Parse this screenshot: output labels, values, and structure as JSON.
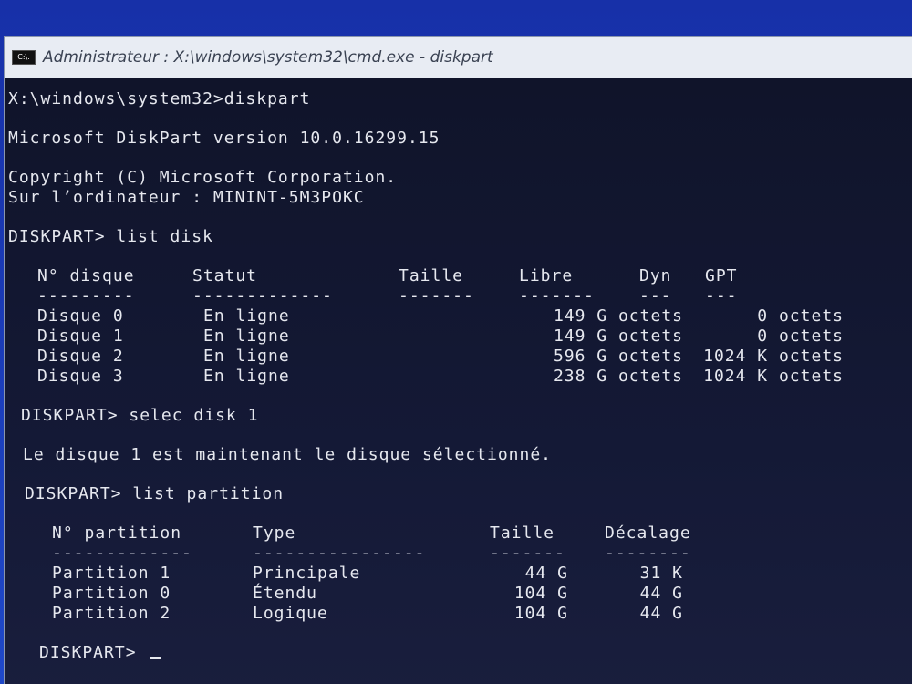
{
  "window": {
    "icon_text": "C:\\.",
    "title": "Administrateur : X:\\windows\\system32\\cmd.exe - diskpart"
  },
  "console": {
    "lines": {
      "cmd1": "X:\\windows\\system32>diskpart",
      "version": "Microsoft DiskPart version 10.0.16299.15",
      "copyright": "Copyright (C) Microsoft Corporation.",
      "computer": "Sur l’ordinateur : MININT-5M3POKC",
      "cmd2": "DISKPART> list disk",
      "cmd3": "DISKPART> selec disk 1",
      "selected_msg": "Le disque 1 est maintenant le disque sélectionné.",
      "cmd4": "DISKPART> list partition",
      "prompt": "DISKPART> "
    },
    "disk_table": {
      "headers": [
        "N° disque",
        "Statut",
        "Taille",
        "Libre",
        "Dyn",
        "GPT"
      ],
      "separators": [
        "---------",
        "-------------",
        "-------",
        "-------",
        "---",
        "---"
      ],
      "rows": [
        [
          "Disque 0",
          "En ligne",
          "149 G octets",
          "0 octets"
        ],
        [
          "Disque 1",
          "En ligne",
          "149 G octets",
          "0 octets"
        ],
        [
          "Disque 2",
          "En ligne",
          "596 G octets",
          "1024 K octets"
        ],
        [
          "Disque 3",
          "En ligne",
          "238 G octets",
          "1024 K octets"
        ]
      ]
    },
    "partition_table": {
      "headers": [
        "N° partition",
        "Type",
        "Taille",
        "Décalage"
      ],
      "separators": [
        "-------------",
        "----------------",
        "-------",
        "--------"
      ],
      "rows": [
        [
          "Partition 1",
          "Principale",
          "44 G",
          "31 K"
        ],
        [
          "Partition 0",
          "Étendu",
          "104 G",
          "44 G"
        ],
        [
          "Partition 2",
          "Logique",
          "104 G",
          "44 G"
        ]
      ]
    }
  }
}
